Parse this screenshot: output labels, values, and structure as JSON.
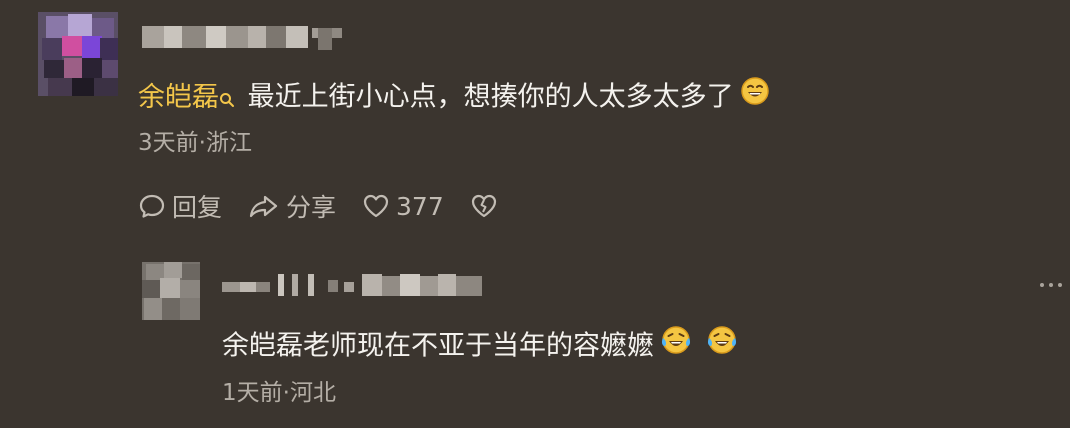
{
  "comments": [
    {
      "mention": "余皑磊",
      "text": "最近上街小心点，想揍你的人太多太多了",
      "emojis": [
        "grin-emoji"
      ],
      "meta": "3天前·浙江",
      "actions": {
        "reply_label": "回复",
        "share_label": "分享",
        "like_count": "377"
      }
    },
    {
      "text": "余皑磊老师现在不亚于当年的容嬷嬷",
      "emojis": [
        "crying-laughing-emoji",
        "crying-laughing-emoji"
      ],
      "meta": "1天前·河北"
    }
  ],
  "colors": {
    "background": "#3b352f",
    "mention": "#f3c64a",
    "text": "#f4f2ee",
    "meta": "#b4aea6"
  }
}
